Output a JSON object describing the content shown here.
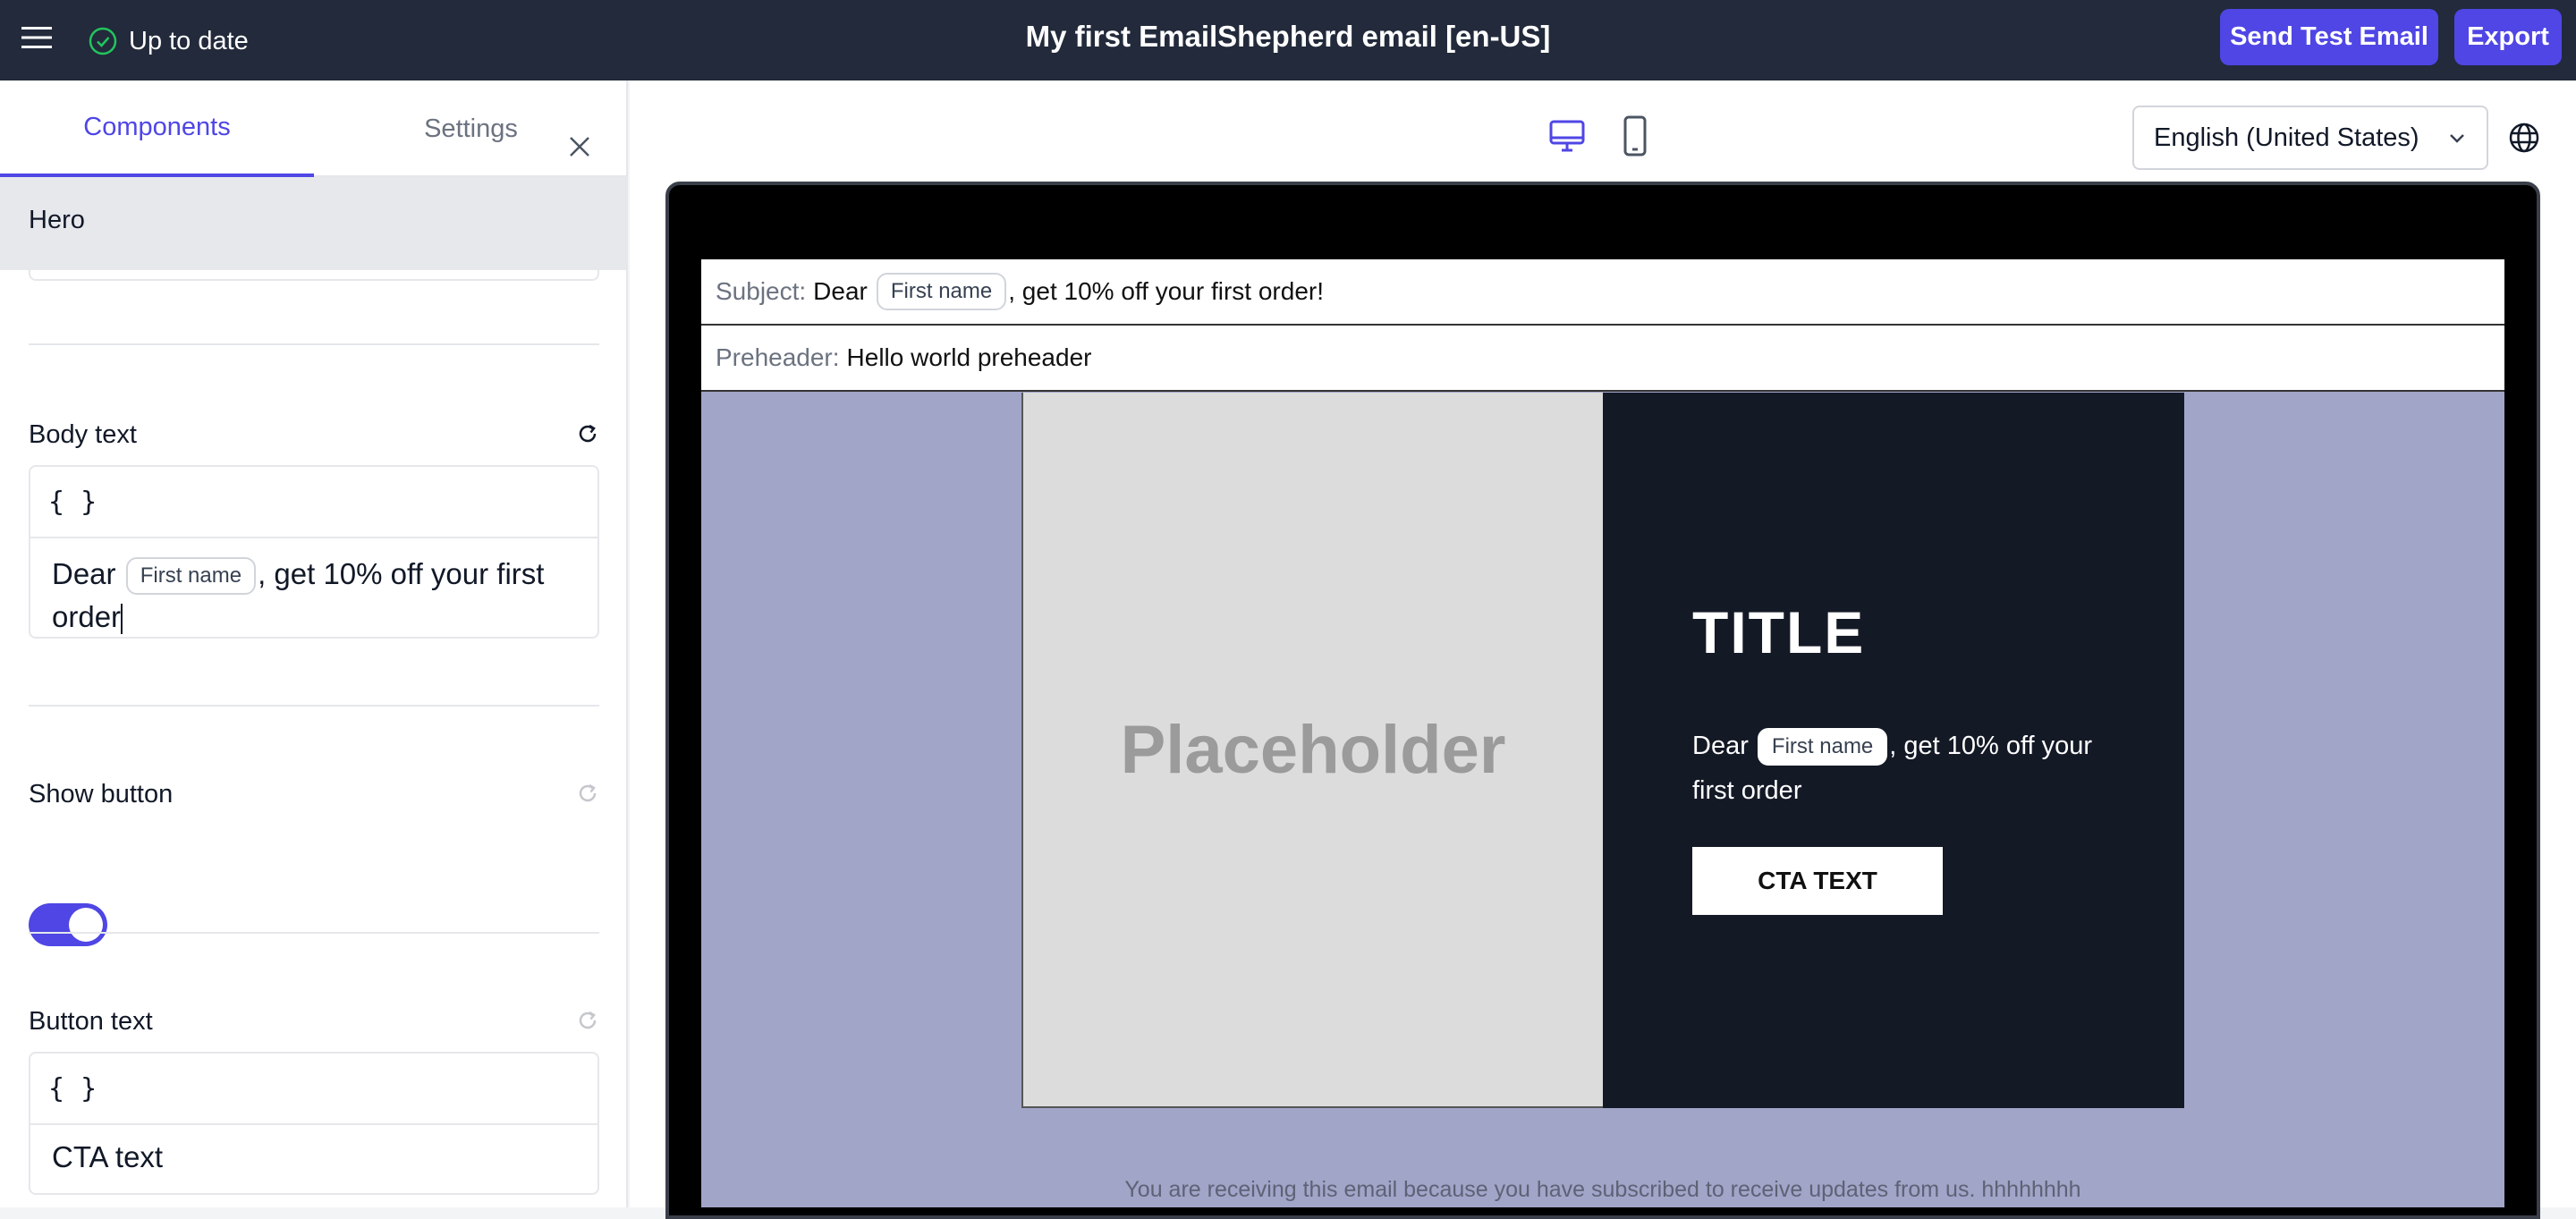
{
  "topbar": {
    "status": "Up to date",
    "title": "My first EmailShepherd email [en-US]",
    "send_test": "Send Test Email",
    "export": "Export"
  },
  "left": {
    "tabs": [
      "Components",
      "Settings"
    ],
    "section": "Hero",
    "body_text": {
      "label": "Body text",
      "toolbar": "{ }",
      "before": "Dear",
      "tag": "First name",
      "after": ", get 10% off your first order"
    },
    "show_button": {
      "label": "Show button",
      "on": true
    },
    "button_text": {
      "label": "Button text",
      "toolbar": "{ }",
      "value": "CTA text"
    }
  },
  "preview": {
    "locale": "English (United States)",
    "subject": {
      "label": "Subject:",
      "before": "Dear",
      "tag": "First name",
      "after": ", get 10% off your first order!"
    },
    "preheader": {
      "label": "Preheader:",
      "value": "Hello world preheader"
    },
    "hero": {
      "image_text": "Placeholder",
      "title": "TITLE",
      "body_before": "Dear",
      "body_tag": "First name",
      "body_after": ", get 10% off your first order",
      "cta": "CTA TEXT"
    },
    "footer": "You are receiving this email because you have subscribed to receive updates from us. hhhhhhhh"
  },
  "colors": {
    "accent": "#4f46e5",
    "topbar": "#222a3b",
    "email_bg": "#a1a5c8",
    "hero_dark": "#141926"
  }
}
